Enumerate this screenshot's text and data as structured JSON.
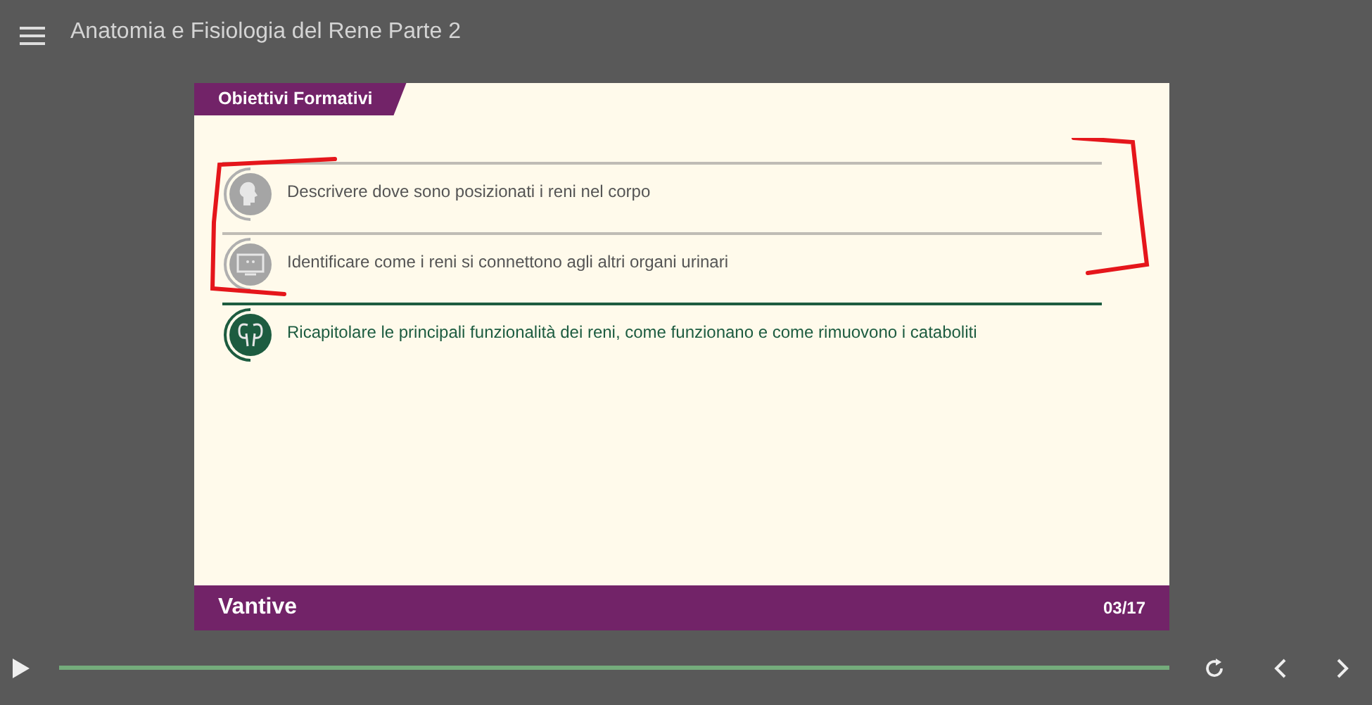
{
  "header": {
    "title": "Anatomia e Fisiologia del Rene Parte 2"
  },
  "slide": {
    "section_tab": "Obiettivi Formativi",
    "objectives": [
      {
        "text": "Descrivere dove sono posizionati i reni nel corpo",
        "selected": false,
        "kind": "head"
      },
      {
        "text": "Identificare come i reni si connettono agli altri organi urinari",
        "selected": false,
        "kind": "screen"
      },
      {
        "text": "Ricapitolare le principali funzionalità dei reni, come funzionano e come rimuovono i cataboliti",
        "selected": true,
        "kind": "kidney"
      }
    ],
    "footer": {
      "logo": "Vantive",
      "page": "03/17"
    }
  },
  "player": {
    "progress": {
      "level": 1.0
    }
  }
}
